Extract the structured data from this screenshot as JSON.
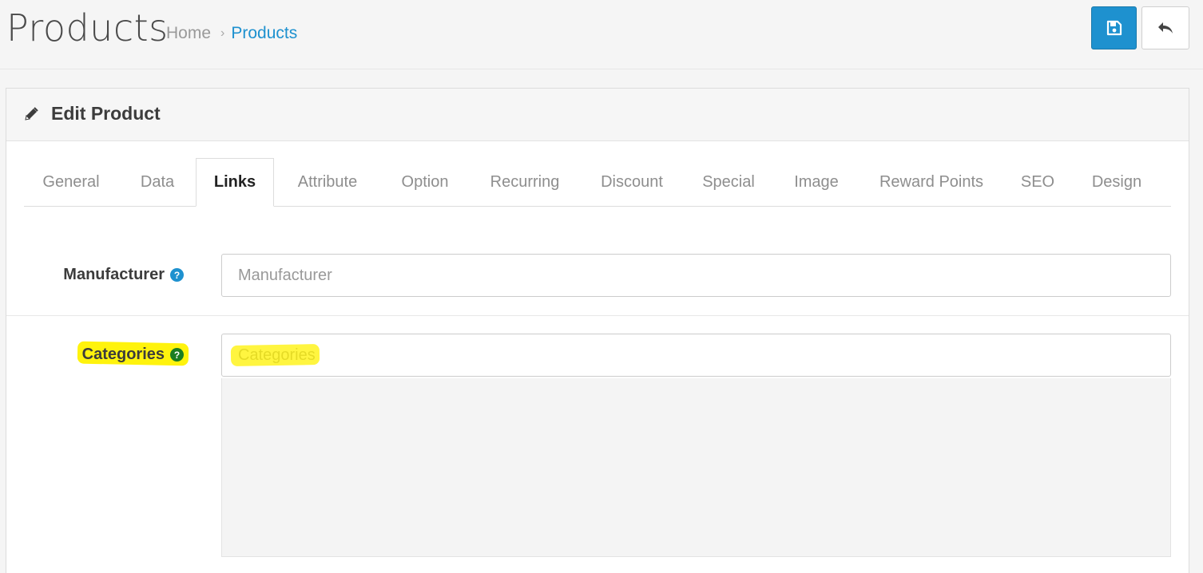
{
  "header": {
    "title": "Products",
    "breadcrumb": [
      {
        "label": "Home"
      },
      {
        "label": "Products"
      }
    ],
    "separator": "›",
    "save_icon": "floppy-disk-icon",
    "back_icon": "reply-arrow-icon"
  },
  "panel": {
    "icon": "pencil-icon",
    "title": "Edit Product"
  },
  "tabs": [
    {
      "label": "General"
    },
    {
      "label": "Data"
    },
    {
      "label": "Links",
      "active": true
    },
    {
      "label": "Attribute"
    },
    {
      "label": "Option"
    },
    {
      "label": "Recurring"
    },
    {
      "label": "Discount"
    },
    {
      "label": "Special"
    },
    {
      "label": "Image"
    },
    {
      "label": "Reward Points"
    },
    {
      "label": "SEO"
    },
    {
      "label": "Design"
    }
  ],
  "form": {
    "manufacturer": {
      "label": "Manufacturer",
      "placeholder": "Manufacturer",
      "help": "?"
    },
    "categories": {
      "label": "Categories",
      "placeholder": "Categories",
      "help": "?"
    }
  },
  "colors": {
    "primary": "#1e91cf",
    "highlight": "#fff200",
    "help_green": "#1a7d22"
  }
}
